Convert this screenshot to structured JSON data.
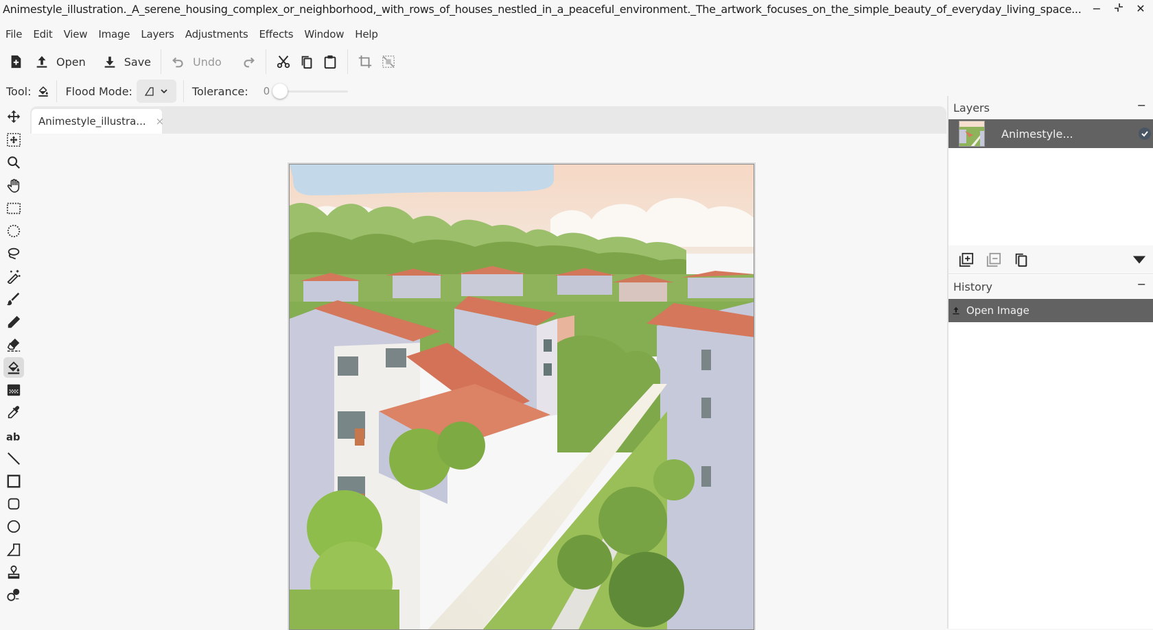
{
  "window": {
    "title": "Animestyle_illustration._A_serene_housing_complex_or_neighborhood,_with_rows_of_houses_nestled_in_a_peaceful_environment._The_artwork_focuses_on_the_simple_beauty_of_everyday_living_space...",
    "minimize_icon": "minimize-icon",
    "restore_icon": "restore-icon",
    "close_icon": "close-icon",
    "minimize_glyph": "−",
    "restore_glyph": "⤡",
    "close_glyph": "✕"
  },
  "menu": {
    "items": [
      "File",
      "Edit",
      "View",
      "Image",
      "Layers",
      "Adjustments",
      "Effects",
      "Window",
      "Help"
    ]
  },
  "toolbar": {
    "new_icon": "new-document-icon",
    "open_label": "Open",
    "save_label": "Save",
    "undo_label": "Undo",
    "redo_icon": "redo-icon",
    "cut_icon": "cut-icon",
    "copy_icon": "copy-icon",
    "paste_icon": "paste-icon",
    "crop_icon": "crop-to-selection-icon",
    "deselect_icon": "deselect-icon"
  },
  "tool_options": {
    "tool_label": "Tool:",
    "tool_icon": "paint-bucket-icon",
    "flood_mode_label": "Flood Mode:",
    "flood_mode_value_icon": "flood-mode-local-icon",
    "tolerance_label": "Tolerance:",
    "tolerance_value": "0",
    "tolerance_fraction": 0
  },
  "tools": [
    {
      "name": "move-selected-tool",
      "icon": "move-icon"
    },
    {
      "name": "move-selection-tool",
      "icon": "move-selection-icon"
    },
    {
      "name": "zoom-tool",
      "icon": "zoom-icon"
    },
    {
      "name": "pan-tool",
      "icon": "hand-icon"
    },
    {
      "name": "rectangle-select-tool",
      "icon": "rectangle-select-icon"
    },
    {
      "name": "ellipse-select-tool",
      "icon": "ellipse-select-icon"
    },
    {
      "name": "lasso-select-tool",
      "icon": "lasso-icon"
    },
    {
      "name": "magic-wand-tool",
      "icon": "magic-wand-icon"
    },
    {
      "name": "paintbrush-tool",
      "icon": "paintbrush-icon"
    },
    {
      "name": "pencil-tool",
      "icon": "pencil-icon"
    },
    {
      "name": "eraser-tool",
      "icon": "eraser-icon"
    },
    {
      "name": "paint-bucket-tool",
      "icon": "paint-bucket-icon",
      "active": true
    },
    {
      "name": "gradient-tool",
      "icon": "gradient-icon"
    },
    {
      "name": "color-picker-tool",
      "icon": "color-picker-icon"
    },
    {
      "name": "text-tool",
      "icon": "text-icon"
    },
    {
      "name": "line-tool",
      "icon": "line-icon"
    },
    {
      "name": "rectangle-tool",
      "icon": "rectangle-icon"
    },
    {
      "name": "rounded-rectangle-tool",
      "icon": "rounded-rectangle-icon"
    },
    {
      "name": "ellipse-tool",
      "icon": "ellipse-icon"
    },
    {
      "name": "freeform-shape-tool",
      "icon": "freeform-shape-icon"
    },
    {
      "name": "clone-stamp-tool",
      "icon": "clone-stamp-icon"
    },
    {
      "name": "recolor-tool",
      "icon": "recolor-icon"
    }
  ],
  "document": {
    "tab_label": "Animestyle_illustra...",
    "close_glyph": "×"
  },
  "layers_panel": {
    "title": "Layers",
    "collapse_glyph": "−",
    "layers": [
      {
        "name": "Animestyle...",
        "visible": true
      }
    ],
    "add_layer_icon": "add-layer-icon",
    "delete_layer_icon": "delete-layer-icon",
    "duplicate_layer_icon": "duplicate-layer-icon",
    "menu_icon": "chevron-down-icon"
  },
  "history_panel": {
    "title": "History",
    "collapse_glyph": "−",
    "items": [
      {
        "label": "Open Image",
        "icon": "open-icon"
      }
    ]
  },
  "colors": {
    "selected_row": "#626263",
    "panel_bg": "#f7f7f7",
    "tab_strip": "#e8e8e8",
    "sky_blue": "#c3d9ea",
    "sky_peach": "#f7dccb",
    "roof": "#d4775a",
    "foliage": "#7fa84a",
    "wall": "#c9cbd8"
  }
}
